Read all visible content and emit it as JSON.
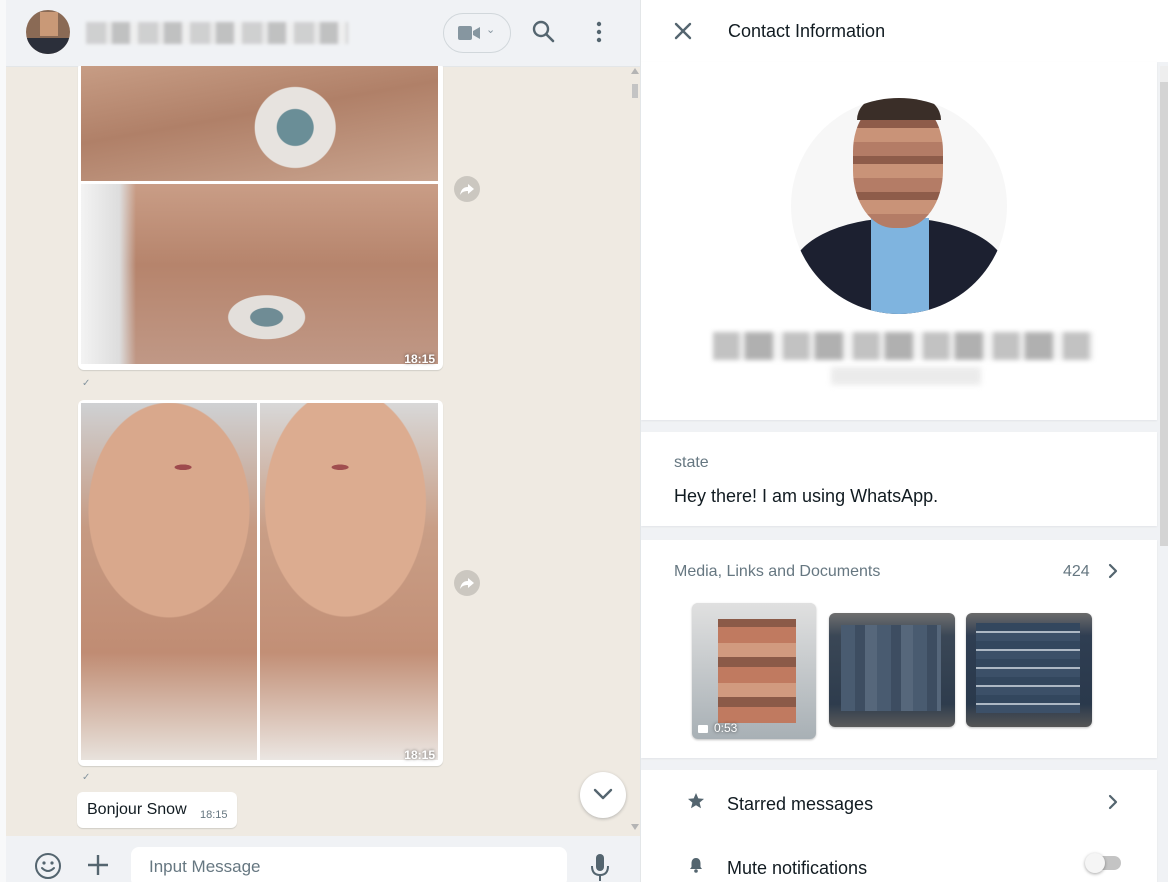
{
  "chat": {
    "messages": [
      {
        "type": "image",
        "time": "18:15"
      },
      {
        "type": "image",
        "time": "18:15"
      },
      {
        "type": "text",
        "text": "Bonjour Snow",
        "time": "18:15"
      }
    ],
    "compose": {
      "placeholder": "Input Message"
    }
  },
  "contact_panel": {
    "title": "Contact Information",
    "status": {
      "label": "state",
      "text": "Hey there! I am using WhatsApp."
    },
    "media": {
      "label": "Media, Links and Documents",
      "count": "424",
      "thumbnails": [
        {
          "duration": "0:53"
        },
        {},
        {}
      ]
    },
    "actions": {
      "starred": "Starred messages",
      "mute": "Mute notifications",
      "mute_enabled": false
    }
  },
  "colors": {
    "chat_background": "#efeae2",
    "header_background": "#f0f2f5",
    "bubble": "#ffffff",
    "secondary_text": "#667781",
    "icon": "#54656f"
  },
  "icons": {
    "header": [
      "video-call-icon",
      "search-icon",
      "menu-icon"
    ],
    "compose": [
      "emoji-icon",
      "plus-icon",
      "mic-icon"
    ],
    "panel": [
      "close-icon",
      "star-icon",
      "bell-icon",
      "chevron-right-icon"
    ]
  }
}
